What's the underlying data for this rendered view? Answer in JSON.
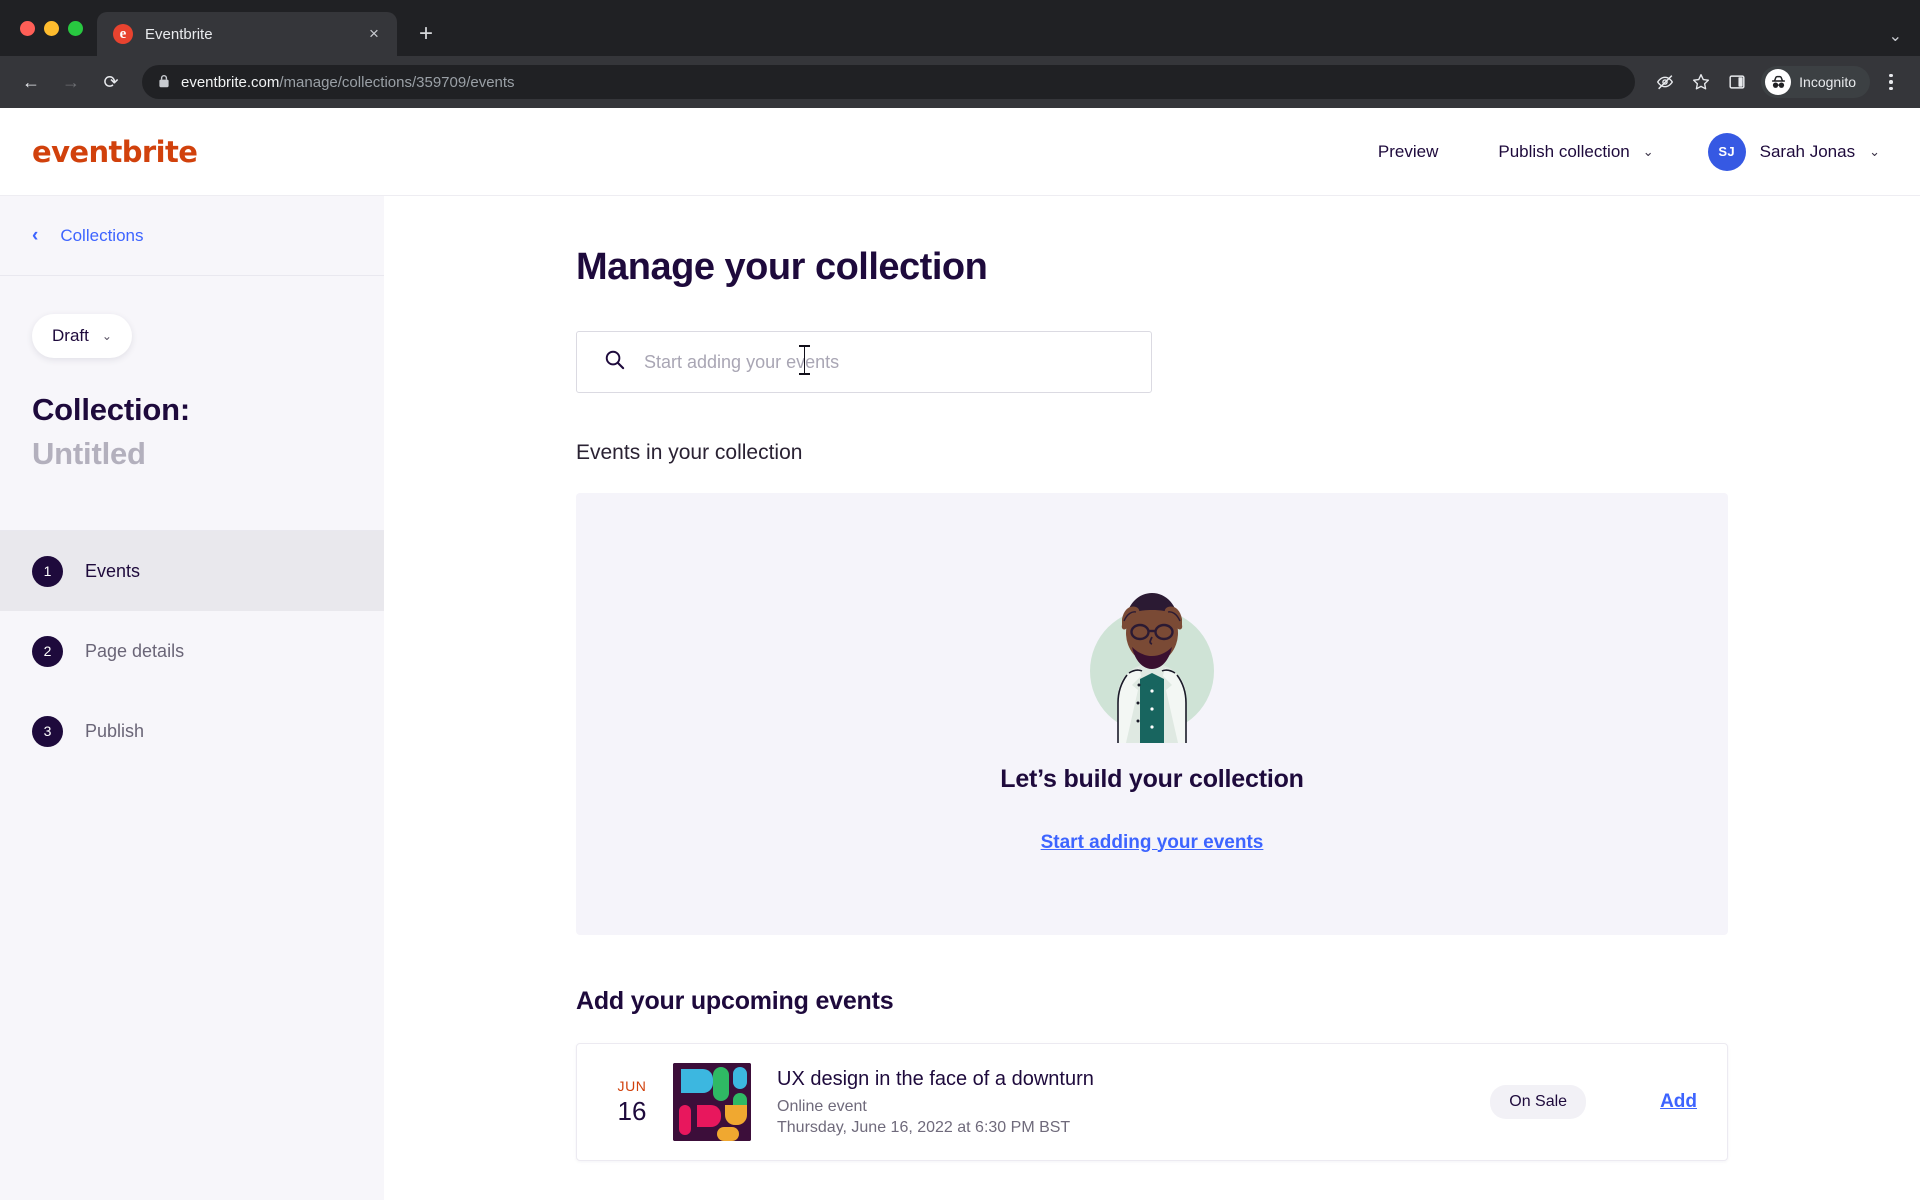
{
  "browser": {
    "tab": {
      "title": "Eventbrite",
      "favicon_letter": "e",
      "favicon_color": "#e8432f"
    },
    "new_tab_label": "+",
    "close_label": "×",
    "tabstrip_expand_label": "⌄",
    "back_label": "←",
    "forward_label": "→",
    "reload_label": "⟳",
    "lock_label": "🔒",
    "url_domain": "eventbrite.com",
    "url_path": "/manage/collections/359709/events",
    "incognito_label": "Incognito",
    "icons": [
      "eye-off-icon",
      "star-icon",
      "side-panel-icon",
      "incognito-icon",
      "more-menu-icon"
    ]
  },
  "header": {
    "logo": "eventbrite",
    "logo_color": "#d1410c",
    "preview_label": "Preview",
    "publish_label": "Publish collection",
    "publish_chevron": "⌄",
    "user_initials": "SJ",
    "user_name": "Sarah Jonas",
    "user_chevron": "⌄",
    "avatar_color": "#3659e3"
  },
  "sidebar": {
    "back_arrow": "‹",
    "breadcrumb_label": "Collections",
    "status": {
      "label": "Draft",
      "chevron": "⌄"
    },
    "collection_label": "Collection:",
    "collection_name": "Untitled",
    "steps": [
      {
        "num": "1",
        "label": "Events",
        "active": true
      },
      {
        "num": "2",
        "label": "Page details",
        "active": false
      },
      {
        "num": "3",
        "label": "Publish",
        "active": false
      }
    ]
  },
  "main": {
    "page_title": "Manage your collection",
    "search": {
      "placeholder": "Start adding your events",
      "icon": "search-icon",
      "value": ""
    },
    "events_section_label": "Events in your collection",
    "empty_state": {
      "illustration": "person-hands-on-head-illustration",
      "title": "Let’s build your collection",
      "link_label": "Start adding your events",
      "background": "#f5f4fa"
    },
    "upcoming_label": "Add your upcoming events",
    "upcoming_events": [
      {
        "month": "JUN",
        "day": "16",
        "title": "UX design in the face of a downturn",
        "location": "Online event",
        "datetime": "Thursday, June 16, 2022 at 6:30 PM BST",
        "badge": "On Sale",
        "action": "Add"
      }
    ]
  },
  "colors": {
    "brand_red": "#d1410c",
    "link_blue": "#3d64ff",
    "ink": "#1e0a3c",
    "panel_bg": "#f5f4fa",
    "sidebar_bg": "#f7f6fa"
  }
}
